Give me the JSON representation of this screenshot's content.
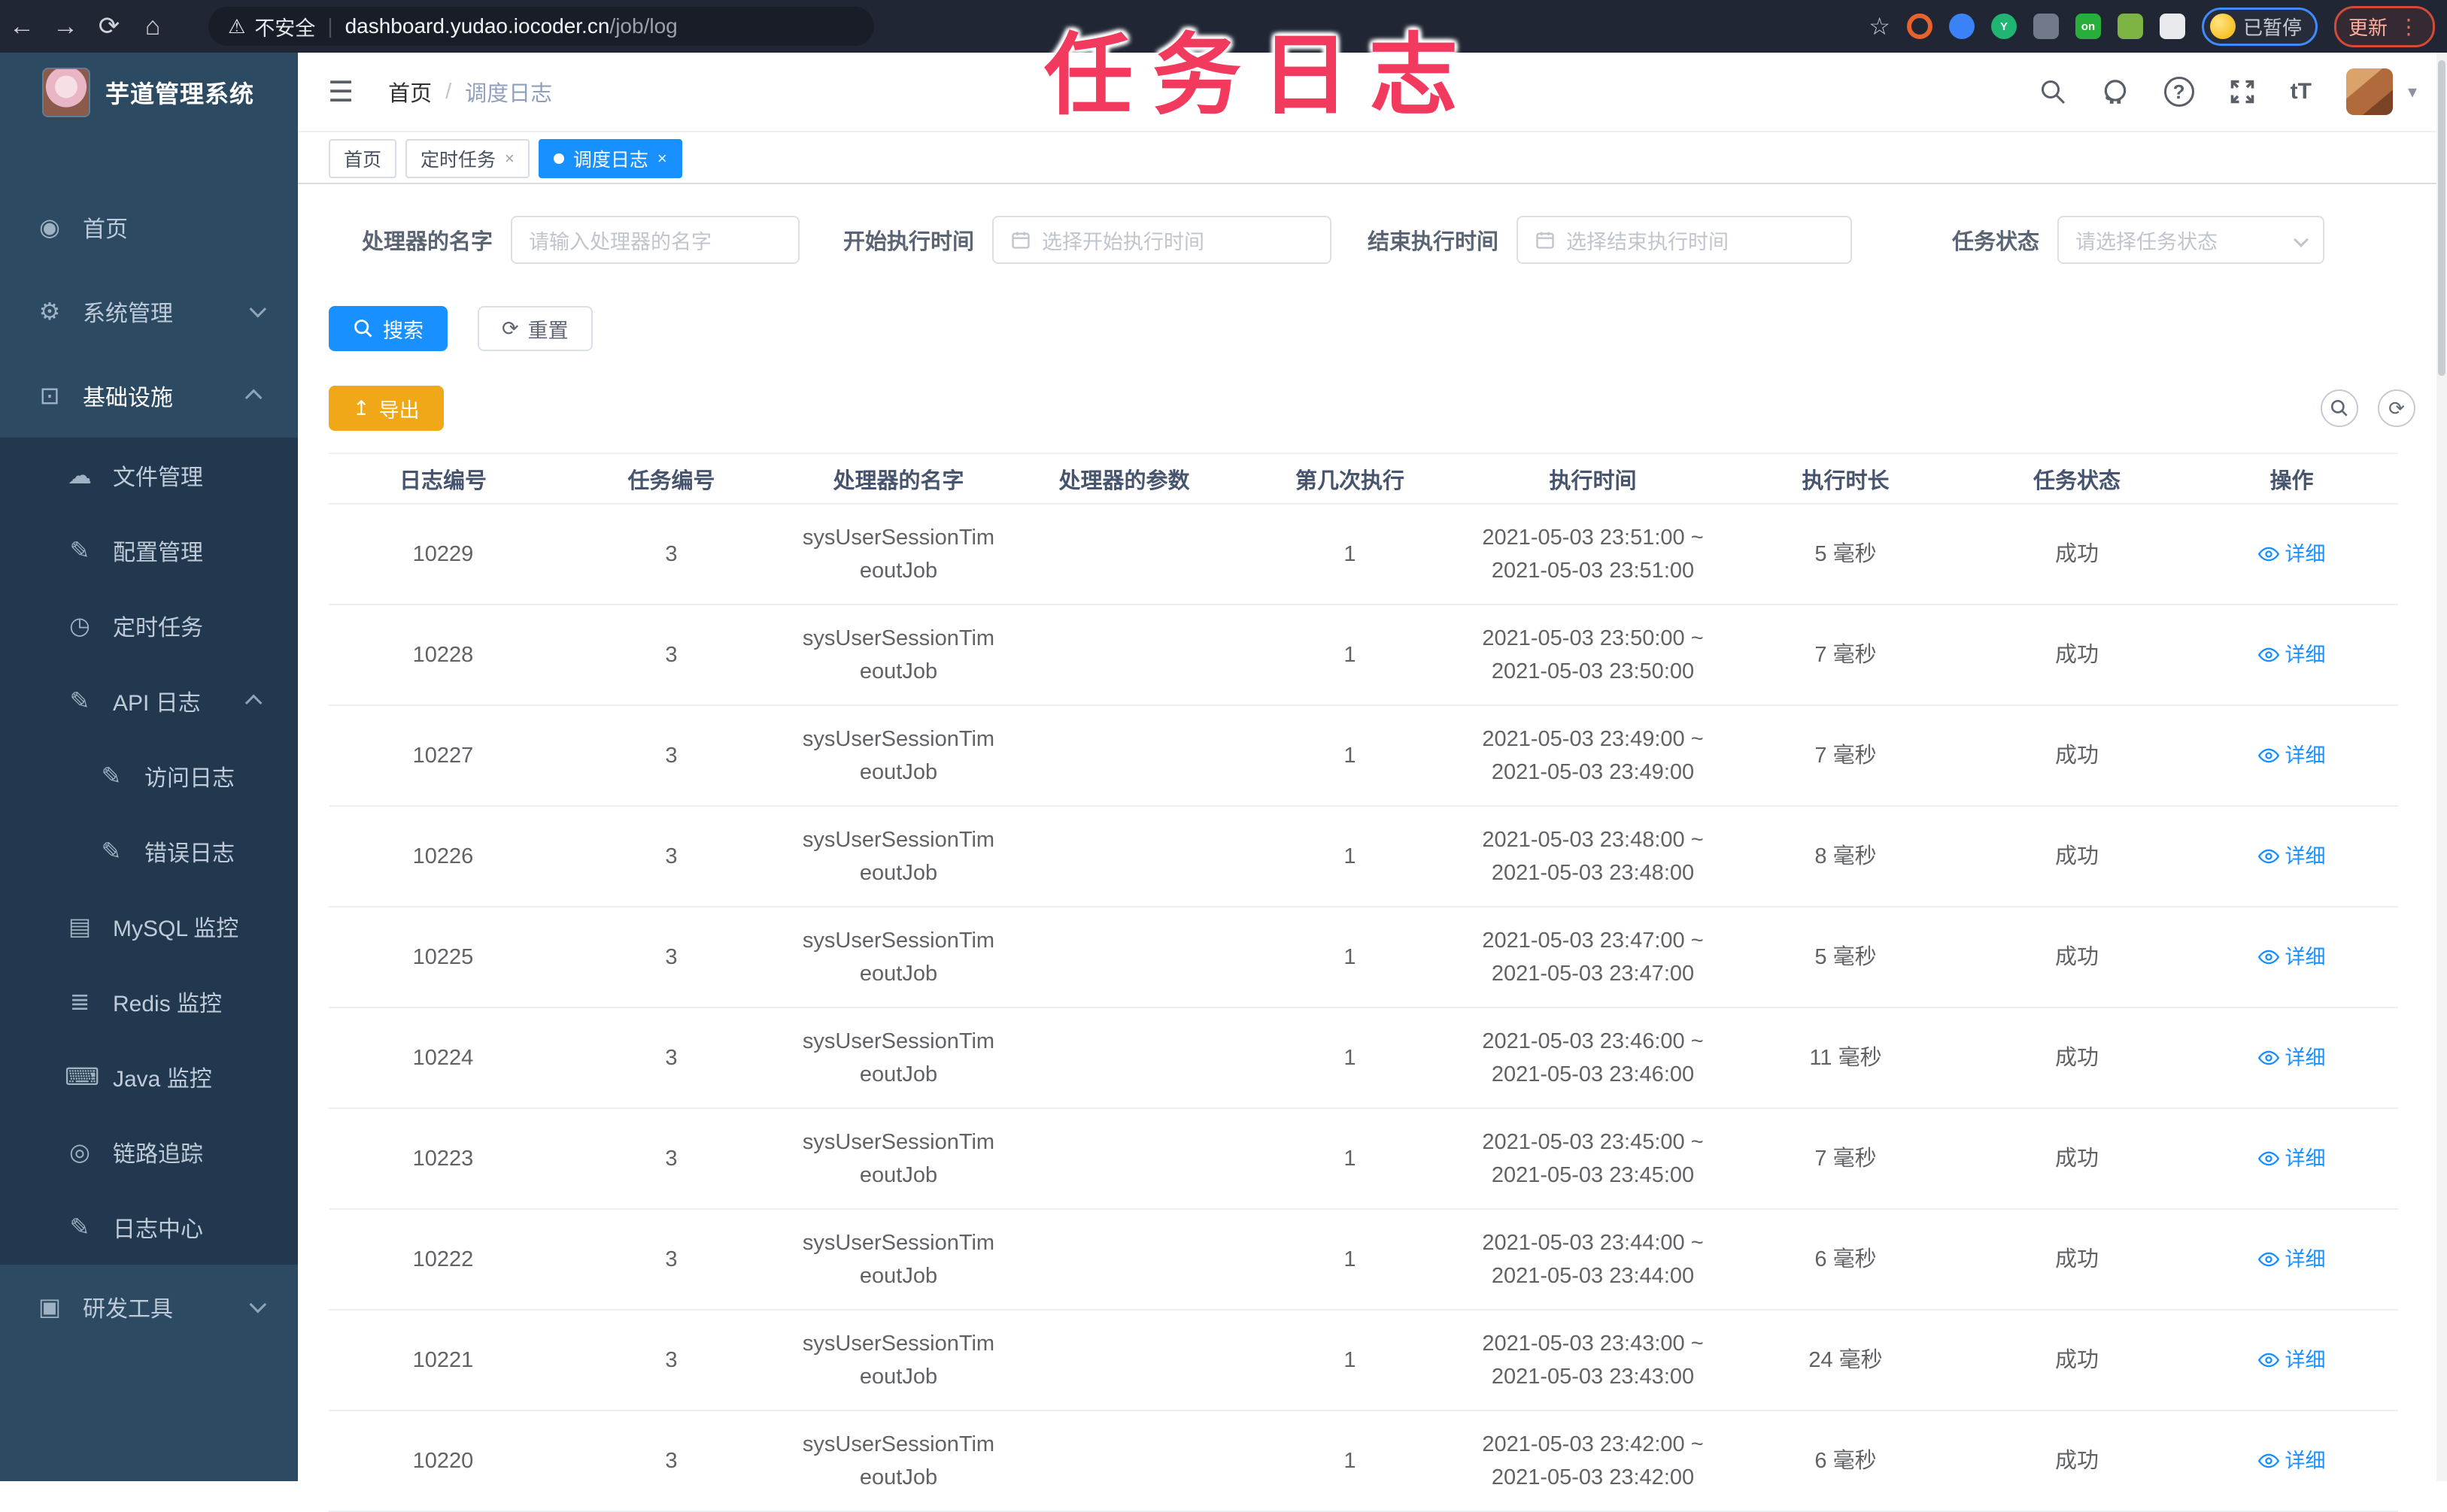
{
  "annotation": "任务日志",
  "browser": {
    "security_label": "不安全",
    "url_host": "dashboard.yudao.iocoder.cn",
    "url_path": "/job/log",
    "paused_badge": "已暂停",
    "update_button": "更新",
    "extensions": [
      {
        "name": "extension-orange-ring",
        "color": "#e8622c",
        "label": ""
      },
      {
        "name": "extension-blue-drop",
        "color": "#3b82f6",
        "label": ""
      },
      {
        "name": "extension-green-y",
        "color": "#21b573",
        "label": "Y"
      },
      {
        "name": "extension-grid",
        "color": "#707a8a",
        "label": ""
      },
      {
        "name": "extension-on-badge",
        "color": "#27ae3b",
        "label": "on"
      },
      {
        "name": "extension-leaf",
        "color": "#7cb342",
        "label": ""
      },
      {
        "name": "extension-puzzle",
        "color": "#e8eaed",
        "label": ""
      }
    ]
  },
  "sidebar": {
    "logo_title": "芋道管理系统",
    "items": [
      {
        "label": "首页",
        "icon": "dashboard-icon",
        "level": 1,
        "sub": false,
        "chevron": ""
      },
      {
        "label": "系统管理",
        "icon": "gear-icon",
        "level": 1,
        "sub": false,
        "chevron": "down"
      },
      {
        "label": "基础设施",
        "icon": "monitor-icon",
        "level": 1,
        "sub": false,
        "chevron": "up",
        "active": true
      },
      {
        "label": "文件管理",
        "icon": "cloud-upload-icon",
        "level": 2,
        "sub": true,
        "chevron": ""
      },
      {
        "label": "配置管理",
        "icon": "edit-icon",
        "level": 2,
        "sub": true,
        "chevron": ""
      },
      {
        "label": "定时任务",
        "icon": "clock-icon",
        "level": 2,
        "sub": true,
        "chevron": ""
      },
      {
        "label": "API 日志",
        "icon": "log-edit-icon",
        "level": 2,
        "sub": true,
        "chevron": "up"
      },
      {
        "label": "访问日志",
        "icon": "edit-icon",
        "level": 3,
        "sub": true,
        "chevron": ""
      },
      {
        "label": "错误日志",
        "icon": "edit-icon",
        "level": 3,
        "sub": true,
        "chevron": ""
      },
      {
        "label": "MySQL 监控",
        "icon": "mysql-monitor-icon",
        "level": 2,
        "sub": true,
        "chevron": ""
      },
      {
        "label": "Redis 监控",
        "icon": "layers-icon",
        "level": 2,
        "sub": true,
        "chevron": ""
      },
      {
        "label": "Java 监控",
        "icon": "java-monitor-icon",
        "level": 2,
        "sub": true,
        "chevron": ""
      },
      {
        "label": "链路追踪",
        "icon": "trace-eye-icon",
        "level": 2,
        "sub": true,
        "chevron": ""
      },
      {
        "label": "日志中心",
        "icon": "log-center-icon",
        "level": 2,
        "sub": true,
        "chevron": ""
      },
      {
        "label": "研发工具",
        "icon": "toolbox-icon",
        "level": 1,
        "sub": false,
        "chevron": "down"
      }
    ]
  },
  "header": {
    "breadcrumb_home": "首页",
    "breadcrumb_sep": "/",
    "breadcrumb_current": "调度日志"
  },
  "tabs": [
    {
      "label": "首页",
      "active": false,
      "closable": false,
      "dot": false
    },
    {
      "label": "定时任务",
      "active": false,
      "closable": true,
      "dot": false
    },
    {
      "label": "调度日志",
      "active": true,
      "closable": true,
      "dot": true
    }
  ],
  "filters": {
    "handler_label": "处理器的名字",
    "handler_placeholder": "请输入处理器的名字",
    "start_label": "开始执行时间",
    "start_placeholder": "选择开始执行时间",
    "end_label": "结束执行时间",
    "end_placeholder": "选择结束执行时间",
    "status_label": "任务状态",
    "status_placeholder": "请选择任务状态"
  },
  "actions": {
    "search": "搜索",
    "reset": "重置",
    "export": "导出"
  },
  "table": {
    "columns": [
      "日志编号",
      "任务编号",
      "处理器的名字",
      "处理器的参数",
      "第几次执行",
      "执行时间",
      "执行时长",
      "任务状态",
      "操作"
    ],
    "detail_label": "详细",
    "rows": [
      {
        "id": "10229",
        "task": "3",
        "handler1": "sysUserSessionTim",
        "handler2": "eoutJob",
        "param": "",
        "seq": "1",
        "time1": "2021-05-03 23:51:00 ~",
        "time2": "2021-05-03 23:51:00",
        "duration": "5 毫秒",
        "status": "成功"
      },
      {
        "id": "10228",
        "task": "3",
        "handler1": "sysUserSessionTim",
        "handler2": "eoutJob",
        "param": "",
        "seq": "1",
        "time1": "2021-05-03 23:50:00 ~",
        "time2": "2021-05-03 23:50:00",
        "duration": "7 毫秒",
        "status": "成功"
      },
      {
        "id": "10227",
        "task": "3",
        "handler1": "sysUserSessionTim",
        "handler2": "eoutJob",
        "param": "",
        "seq": "1",
        "time1": "2021-05-03 23:49:00 ~",
        "time2": "2021-05-03 23:49:00",
        "duration": "7 毫秒",
        "status": "成功"
      },
      {
        "id": "10226",
        "task": "3",
        "handler1": "sysUserSessionTim",
        "handler2": "eoutJob",
        "param": "",
        "seq": "1",
        "time1": "2021-05-03 23:48:00 ~",
        "time2": "2021-05-03 23:48:00",
        "duration": "8 毫秒",
        "status": "成功"
      },
      {
        "id": "10225",
        "task": "3",
        "handler1": "sysUserSessionTim",
        "handler2": "eoutJob",
        "param": "",
        "seq": "1",
        "time1": "2021-05-03 23:47:00 ~",
        "time2": "2021-05-03 23:47:00",
        "duration": "5 毫秒",
        "status": "成功"
      },
      {
        "id": "10224",
        "task": "3",
        "handler1": "sysUserSessionTim",
        "handler2": "eoutJob",
        "param": "",
        "seq": "1",
        "time1": "2021-05-03 23:46:00 ~",
        "time2": "2021-05-03 23:46:00",
        "duration": "11 毫秒",
        "status": "成功"
      },
      {
        "id": "10223",
        "task": "3",
        "handler1": "sysUserSessionTim",
        "handler2": "eoutJob",
        "param": "",
        "seq": "1",
        "time1": "2021-05-03 23:45:00 ~",
        "time2": "2021-05-03 23:45:00",
        "duration": "7 毫秒",
        "status": "成功"
      },
      {
        "id": "10222",
        "task": "3",
        "handler1": "sysUserSessionTim",
        "handler2": "eoutJob",
        "param": "",
        "seq": "1",
        "time1": "2021-05-03 23:44:00 ~",
        "time2": "2021-05-03 23:44:00",
        "duration": "6 毫秒",
        "status": "成功"
      },
      {
        "id": "10221",
        "task": "3",
        "handler1": "sysUserSessionTim",
        "handler2": "eoutJob",
        "param": "",
        "seq": "1",
        "time1": "2021-05-03 23:43:00 ~",
        "time2": "2021-05-03 23:43:00",
        "duration": "24 毫秒",
        "status": "成功"
      },
      {
        "id": "10220",
        "task": "3",
        "handler1": "sysUserSessionTim",
        "handler2": "eoutJob",
        "param": "",
        "seq": "1",
        "time1": "2021-05-03 23:42:00 ~",
        "time2": "2021-05-03 23:42:00",
        "duration": "6 毫秒",
        "status": "成功"
      }
    ]
  },
  "colors": {
    "accent_blue": "#1890ff",
    "warning_yellow": "#f0a818",
    "annotation_pink": "#f23a5f",
    "sidebar_bg": "#2d4a63",
    "sidebar_sub_bg": "#22384e"
  }
}
